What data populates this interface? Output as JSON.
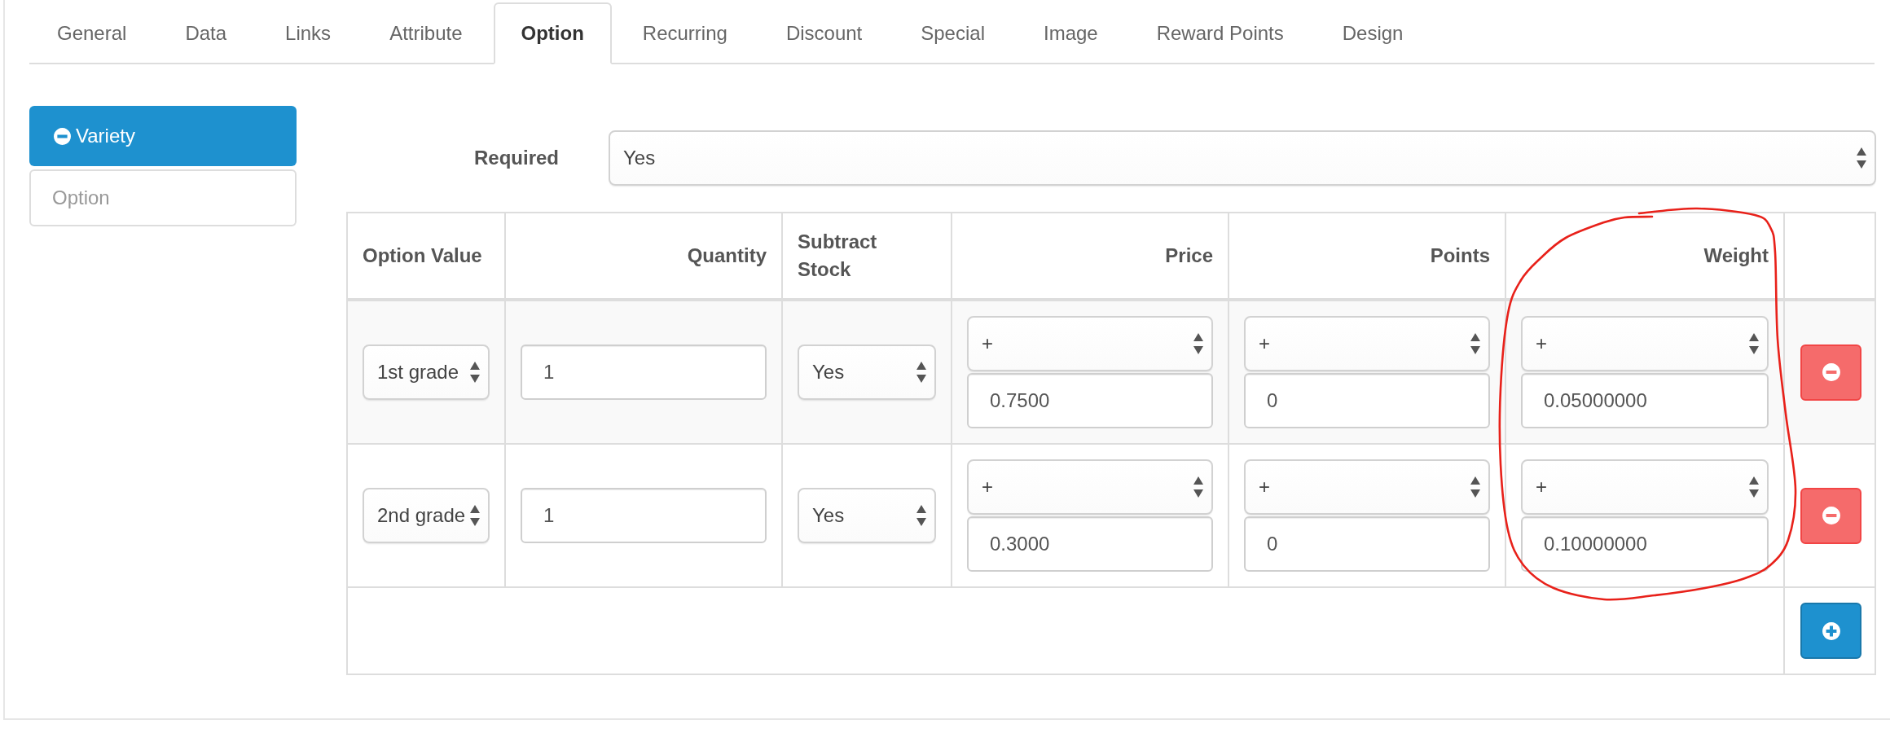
{
  "tabs": [
    {
      "label": "General",
      "selected": false
    },
    {
      "label": "Data",
      "selected": false
    },
    {
      "label": "Links",
      "selected": false
    },
    {
      "label": "Attribute",
      "selected": false
    },
    {
      "label": "Option",
      "selected": true
    },
    {
      "label": "Recurring",
      "selected": false
    },
    {
      "label": "Discount",
      "selected": false
    },
    {
      "label": "Special",
      "selected": false
    },
    {
      "label": "Image",
      "selected": false
    },
    {
      "label": "Reward Points",
      "selected": false
    },
    {
      "label": "Design",
      "selected": false
    }
  ],
  "option_list": [
    {
      "label": "Variety",
      "selected": true
    }
  ],
  "option_search": {
    "placeholder": "Option"
  },
  "required": {
    "label": "Required",
    "value": "Yes"
  },
  "table": {
    "columns": [
      {
        "label": "Option Value",
        "kind": "text"
      },
      {
        "label": "Quantity",
        "kind": "number"
      },
      {
        "label": "Subtract Stock",
        "kind": "text"
      },
      {
        "label": "Price",
        "kind": "number"
      },
      {
        "label": "Points",
        "kind": "number"
      },
      {
        "label": "Weight",
        "kind": "number"
      }
    ],
    "rows": [
      {
        "option_value": "1st grade",
        "quantity": "1",
        "subtract": "Yes",
        "price_prefix": "+",
        "price": "0.7500",
        "points_prefix": "+",
        "points": "0",
        "weight_prefix": "+",
        "weight": "0.05000000"
      },
      {
        "option_value": "2nd grade",
        "quantity": "1",
        "subtract": "Yes",
        "price_prefix": "+",
        "price": "0.3000",
        "points_prefix": "+",
        "points": "0",
        "weight_prefix": "+",
        "weight": "0.10000000"
      }
    ]
  },
  "annotation": {
    "kind": "circle"
  }
}
